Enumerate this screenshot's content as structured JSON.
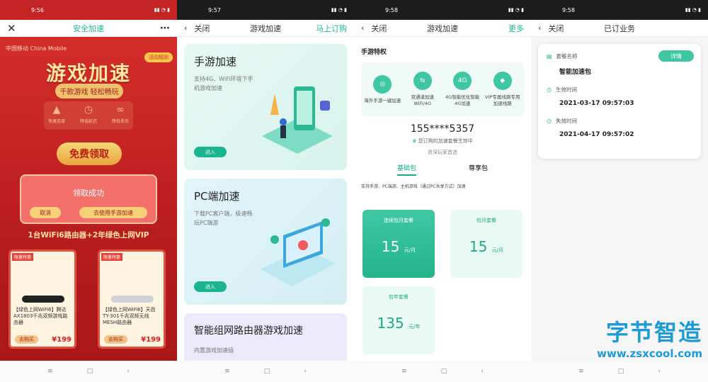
{
  "status_time": [
    "9:56",
    "9:57",
    "9:58",
    "9:58"
  ],
  "phone1": {
    "nav_title": "安全加速",
    "logo": "中国移动 China Mobile",
    "activity": "活动规则",
    "title": "游戏加速",
    "slogan": "千款游戏 轻松畅玩",
    "features": [
      "快速连接",
      "降低延迟",
      "降低丢包"
    ],
    "free_btn": "免费领取",
    "modal": {
      "title": "领取成功",
      "cancel": "取消",
      "go": "去使用手游加速"
    },
    "promo": "1台WiFi6路由器+2年绿色上网VIP",
    "products": [
      {
        "tag": "限量特惠",
        "name": "【绿色上网WiFi6】腾达AX1803千兆双频游戏路由器",
        "price": "¥199",
        "buy": "去购买"
      },
      {
        "tag": "限量特惠",
        "name": "【绿色上网WiFi6】天邑TY-301千兆双频无线MESH路由器",
        "price": "¥199",
        "buy": "去购买"
      }
    ]
  },
  "phone2": {
    "back": "关闭",
    "title": "游戏加速",
    "right": "马上订购",
    "cards": [
      {
        "title": "手游加速",
        "desc": "支持4G、WiFi环境下手机游戏加速",
        "btn": "进入"
      },
      {
        "title": "PC端加速",
        "desc": "下载PC客户端，极速畅玩PC端游",
        "btn": "进入"
      },
      {
        "title": "智能组网路由器游戏加速",
        "desc": "内置游戏加速插"
      }
    ]
  },
  "phone3": {
    "back": "关闭",
    "title": "游戏加速",
    "right": "更多",
    "section": "手游特权",
    "privileges": [
      "海外手游一键加速",
      "双通道加速WiFi/4G",
      "4G智能优化智能4G加速",
      "VIP专属线路专用加速线路"
    ],
    "phone": "155****5357",
    "notice": "您订购的加速套餐生效中",
    "pref": "资深玩家首选",
    "tabs": [
      "基础包",
      "尊享包"
    ],
    "support": "支持手游、PC端游、主机游戏（通过PC共享方式）加速",
    "plans": [
      {
        "name": "连续包月套餐",
        "price": "15",
        "unit": "元/月"
      },
      {
        "name": "包月套餐",
        "price": "15",
        "unit": "元/月"
      },
      {
        "name": "包年套餐",
        "price": "135",
        "unit": "元/年"
      }
    ]
  },
  "phone4": {
    "back": "关闭",
    "title": "已订业务",
    "detail": "详情",
    "package_label": "套餐名称",
    "package_value": "智能加速包",
    "start_label": "生效时间",
    "start_value": "2021-03-17 09:57:03",
    "end_label": "失效时间",
    "end_value": "2021-04-17 09:57:02"
  },
  "watermark": {
    "text": "字节智造",
    "url": "www.zsxcool.com"
  }
}
